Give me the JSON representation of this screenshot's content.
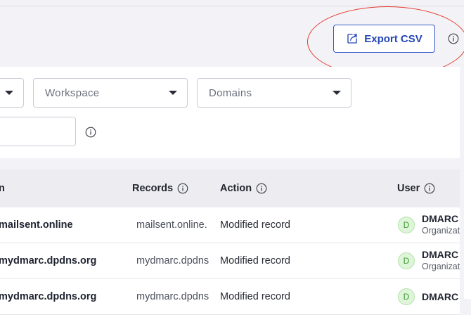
{
  "header": {
    "export_label": "Export CSV",
    "export_icon": "export-icon",
    "info_icon": "info-icon"
  },
  "filters": {
    "first_select": "",
    "workspace_placeholder": "Workspace",
    "domains_placeholder": "Domains",
    "text_value": ""
  },
  "table": {
    "columns": {
      "domain": "n",
      "records": "Records",
      "action": "Action",
      "user": "User"
    },
    "rows": [
      {
        "domain": "mailsent.online",
        "records": "mailsent.online.",
        "action": "Modified record",
        "avatar": "D",
        "user": "DMARC",
        "org": "Organizat"
      },
      {
        "domain": "mydmarc.dpdns.org",
        "records": "mydmarc.dpdns",
        "action": "Modified record",
        "avatar": "D",
        "user": "DMARC",
        "org": "Organizat"
      },
      {
        "domain": "mydmarc.dpdns.org",
        "records": "mydmarc.dpdns",
        "action": "Modified record",
        "avatar": "D",
        "user": "DMARC",
        "org": ""
      }
    ]
  },
  "colors": {
    "accent": "#2346b6",
    "annotation": "#e23b2e",
    "avatar_bg": "#dff5d9",
    "avatar_fg": "#3e9b33"
  }
}
